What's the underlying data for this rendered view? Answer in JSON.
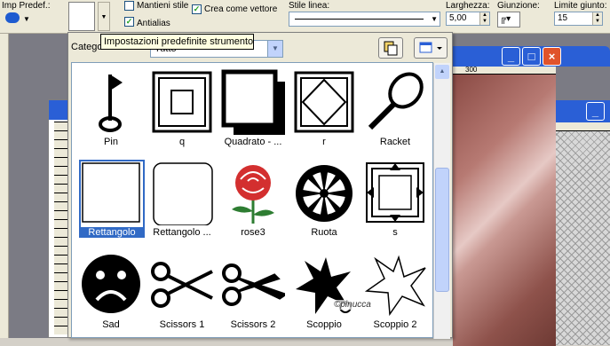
{
  "toolbar": {
    "preset_label": "Imp Predef.:",
    "keep_style_label": "Mantieni stile",
    "create_vector_label": "Crea come vettore",
    "antialias_label": "Antialias",
    "line_style_label": "Stile linea:",
    "width_label": "Larghezza:",
    "width_value": "5,00",
    "join_label": "Giunzione:",
    "miter_label": "Limite giunto:",
    "miter_value": "15",
    "keep_style_checked": false,
    "create_vector_checked": true,
    "antialias_checked": true
  },
  "ruler": {
    "mark": "300"
  },
  "popup": {
    "category_label": "Catego",
    "category_value": "Tutto",
    "tooltip": "Impostazioni predefinite strumento"
  },
  "shapes": [
    {
      "name": "Pin",
      "icon": "pin-icon"
    },
    {
      "name": "q",
      "icon": "square-frame-icon"
    },
    {
      "name": "Quadrato - ...",
      "icon": "shadow-square-icon"
    },
    {
      "name": "r",
      "icon": "diamond-frame-icon"
    },
    {
      "name": "Racket",
      "icon": "racket-icon"
    },
    {
      "name": "Rettangolo",
      "icon": "rectangle-icon",
      "selected": true
    },
    {
      "name": "Rettangolo ...",
      "icon": "rounded-rectangle-icon"
    },
    {
      "name": "rose3",
      "icon": "rose-icon"
    },
    {
      "name": "Ruota",
      "icon": "wheel-icon"
    },
    {
      "name": "s",
      "icon": "arrow-frame-icon"
    },
    {
      "name": "Sad",
      "icon": "sad-face-icon"
    },
    {
      "name": "Scissors 1",
      "icon": "scissors-icon"
    },
    {
      "name": "Scissors 2",
      "icon": "scissors-icon"
    },
    {
      "name": "Scoppio",
      "icon": "burst-icon"
    },
    {
      "name": "Scoppio 2",
      "icon": "burst-outline-icon"
    }
  ],
  "watermark": "©pinucca",
  "colors": {
    "selection": "#316ac5",
    "scrollbar": "#c1d3fb",
    "title_bar": "#2a5fd6",
    "close_button": "#e0532b"
  }
}
